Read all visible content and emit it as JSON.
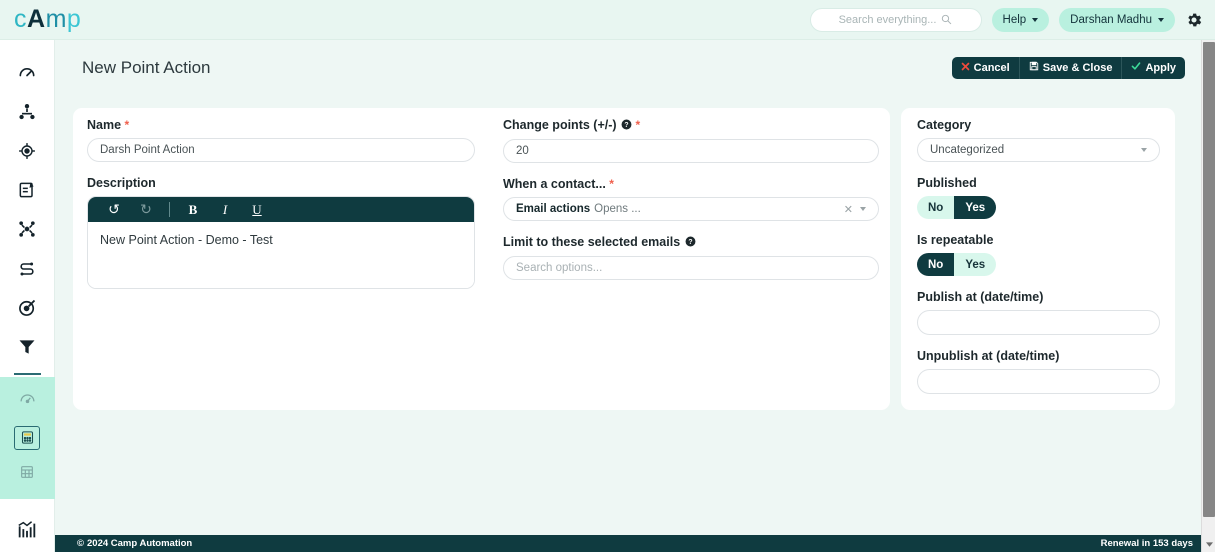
{
  "brand": {
    "logo_parts": [
      "c",
      "A",
      "m",
      "p"
    ],
    "logo_text": "cAmp"
  },
  "header": {
    "search": {
      "placeholder": "Search everything...",
      "icon": "search-icon"
    },
    "help_label": "Help",
    "user_label": "Darshan Madhu",
    "settings_icon": "gear-icon"
  },
  "sidebar": {
    "items": [
      {
        "icon": "dashboard-gauge-icon",
        "active": false
      },
      {
        "icon": "contacts-hierarchy-icon",
        "active": false
      },
      {
        "icon": "target-crosshair-icon",
        "active": false
      },
      {
        "icon": "form-edit-icon",
        "active": false
      },
      {
        "icon": "network-share-icon",
        "active": false
      },
      {
        "icon": "workflow-icon",
        "active": false
      },
      {
        "icon": "goal-target-icon",
        "active": false
      },
      {
        "icon": "funnel-icon",
        "active": false
      }
    ],
    "group_items": [
      {
        "icon": "speedometer-icon",
        "active": false
      },
      {
        "icon": "calculator-icon",
        "active": true
      },
      {
        "icon": "grid-table-icon",
        "active": false
      }
    ],
    "bottom_items": [
      {
        "icon": "analytics-chart-icon",
        "active": false
      }
    ]
  },
  "page": {
    "title": "New Point Action",
    "actions": [
      {
        "label": "Cancel",
        "icon": "close-x-icon",
        "icon_color": "#ef4b3c"
      },
      {
        "label": "Save & Close",
        "icon": "save-disk-icon",
        "icon_color": "#ffffff"
      },
      {
        "label": "Apply",
        "icon": "check-icon",
        "icon_color": "#3ddc9a"
      }
    ]
  },
  "form": {
    "name": {
      "label": "Name",
      "required": "*",
      "value": "Darsh Point Action"
    },
    "description": {
      "label": "Description",
      "toolbar": [
        {
          "name": "undo-icon",
          "glyph": "↺",
          "disabled": false
        },
        {
          "name": "redo-icon",
          "glyph": "↻",
          "disabled": true
        },
        {
          "name": "bold-icon",
          "glyph": "B",
          "disabled": false
        },
        {
          "name": "italic-icon",
          "glyph": "I",
          "disabled": false
        },
        {
          "name": "underline-icon",
          "glyph": "U",
          "disabled": false
        }
      ],
      "content": "New Point Action - Demo - Test"
    },
    "change_points": {
      "label": "Change points (+/-)",
      "required": "*",
      "has_help": true,
      "value": "20"
    },
    "when_contact": {
      "label": "When a contact...",
      "required": "*",
      "group": "Email actions",
      "value": "Opens ...",
      "clear_icon": "clear-x-icon",
      "dropdown_icon": "chevron-down-icon"
    },
    "limit_emails": {
      "label": "Limit to these selected emails",
      "has_help": true,
      "placeholder": "Search options..."
    }
  },
  "panel": {
    "category": {
      "label": "Category",
      "value": "Uncategorized"
    },
    "published": {
      "label": "Published",
      "options": [
        "No",
        "Yes"
      ],
      "selected": "Yes"
    },
    "is_repeatable": {
      "label": "Is repeatable",
      "options": [
        "No",
        "Yes"
      ],
      "selected": "No"
    },
    "publish_at": {
      "label": "Publish at (date/time)",
      "value": ""
    },
    "unpublish_at": {
      "label": "Unpublish at (date/time)",
      "value": ""
    }
  },
  "footer": {
    "copyright": "2024 Camp Automation",
    "copyright_symbol": "©",
    "renewal": "Renewal in 153 days"
  },
  "colors": {
    "brand_teal": "#0f3b40",
    "mint": "#b9f0df",
    "page_bg": "#eef7f4",
    "required_red": "#f0604d",
    "accent_cyan": "#2fb6c4"
  }
}
